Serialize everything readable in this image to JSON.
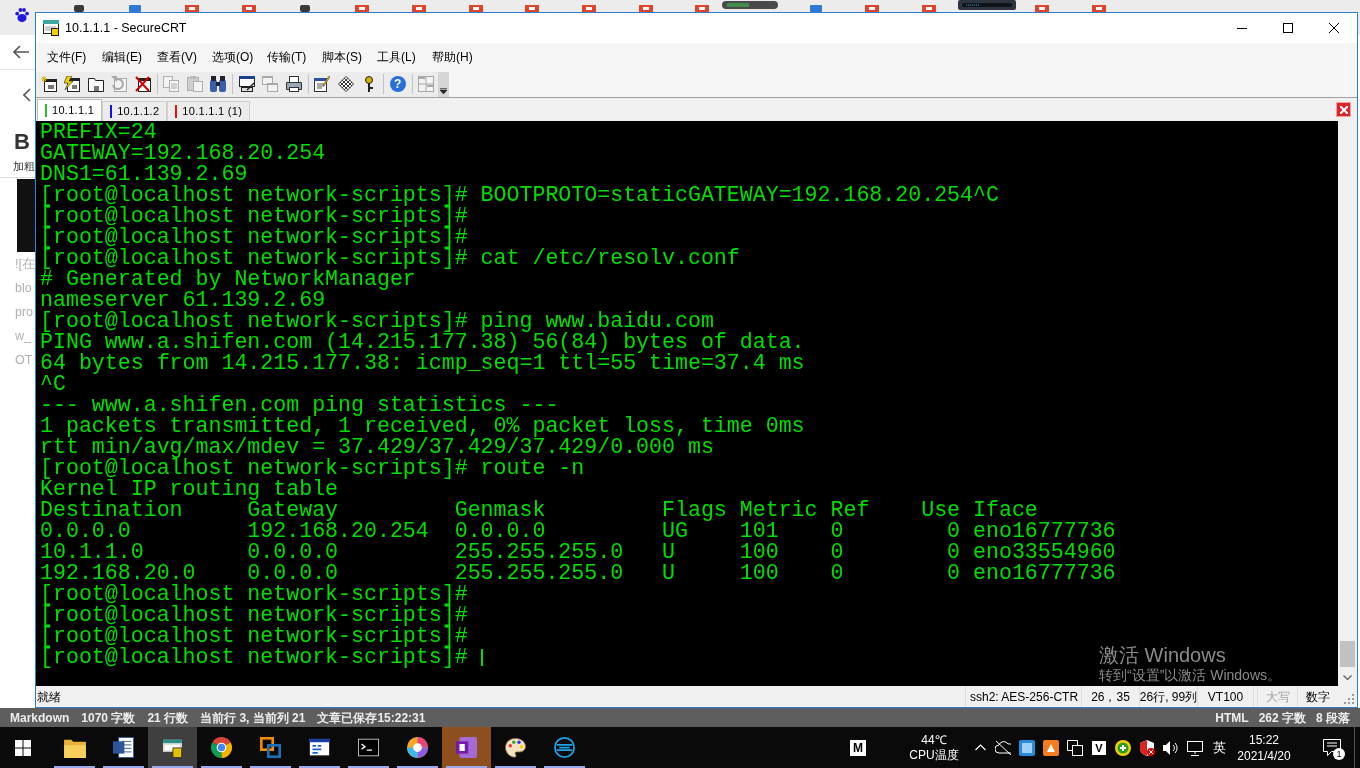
{
  "browser": {
    "editor_toolbar": {
      "bold_glyph": "B",
      "bold_label": "加粗"
    },
    "editor_lines": [
      "![在",
      "blo",
      "pro",
      "w_",
      "OT"
    ],
    "status_bar": {
      "left": [
        "Markdown",
        "1070 字数",
        "21 行数",
        "当前行 3, 当前列 21",
        "文章已保存15:22:31"
      ],
      "right": [
        "HTML",
        "262 字数",
        "8 段落"
      ]
    }
  },
  "window": {
    "title": "10.1.1.1 - SecureCRT",
    "menu": [
      "文件(F)",
      "编辑(E)",
      "查看(V)",
      "选项(O)",
      "传输(T)",
      "脚本(S)",
      "工具(L)",
      "帮助(H)"
    ],
    "toolbar": [
      [
        {
          "kind": "sparkle",
          "disabled": false
        },
        {
          "kind": "lightning",
          "disabled": false
        },
        {
          "kind": "tabfolder",
          "disabled": false
        },
        {
          "kind": "refresh",
          "disabled": true
        },
        {
          "kind": "cross",
          "disabled": false
        }
      ],
      [
        {
          "kind": "copy",
          "disabled": true
        },
        {
          "kind": "paste",
          "disabled": true
        },
        {
          "kind": "binoculars",
          "disabled": false
        }
      ],
      [
        {
          "kind": "screenpen",
          "disabled": false
        },
        {
          "kind": "screens",
          "disabled": true
        },
        {
          "kind": "printer",
          "disabled": false
        }
      ],
      [
        {
          "kind": "docpen",
          "disabled": false
        },
        {
          "kind": "checker",
          "disabled": false
        },
        {
          "kind": "key",
          "disabled": false
        }
      ],
      [
        {
          "kind": "help",
          "glyph": "?",
          "disabled": false
        }
      ],
      [
        {
          "kind": "tiles",
          "disabled": true
        }
      ]
    ],
    "tabs": [
      {
        "label": "10.1.1.1",
        "color": "#22c022",
        "selected": true
      },
      {
        "label": "10.1.1.2",
        "color": "#1010f0",
        "selected": false
      },
      {
        "label": "10.1.1.1 (1)",
        "color": "#f01010",
        "selected": false
      }
    ],
    "terminal": {
      "lines": [
        "PREFIX=24",
        "GATEWAY=192.168.20.254",
        "DNS1=61.139.2.69",
        "[root@localhost network-scripts]# BOOTPROTO=staticGATEWAY=192.168.20.254^C",
        "[root@localhost network-scripts]#",
        "[root@localhost network-scripts]#",
        "[root@localhost network-scripts]# cat /etc/resolv.conf",
        "# Generated by NetworkManager",
        "nameserver 61.139.2.69",
        "[root@localhost network-scripts]# ping www.baidu.com",
        "PING www.a.shifen.com (14.215.177.38) 56(84) bytes of data.",
        "64 bytes from 14.215.177.38: icmp_seq=1 ttl=55 time=37.4 ms",
        "^C",
        "--- www.a.shifen.com ping statistics ---",
        "1 packets transmitted, 1 received, 0% packet loss, time 0ms",
        "rtt min/avg/max/mdev = 37.429/37.429/37.429/0.000 ms",
        "[root@localhost network-scripts]# route -n",
        "Kernel IP routing table",
        "Destination     Gateway         Genmask         Flags Metric Ref    Use Iface",
        "0.0.0.0         192.168.20.254  0.0.0.0         UG    101    0        0 eno16777736",
        "10.1.1.0        0.0.0.0         255.255.255.0   U     100    0        0 eno33554960",
        "192.168.20.0    0.0.0.0         255.255.255.0   U     100    0        0 eno16777736",
        "[root@localhost network-scripts]#",
        "[root@localhost network-scripts]#",
        "[root@localhost network-scripts]#",
        "[root@localhost network-scripts]# "
      ],
      "cursor": true
    },
    "status_bar": {
      "message": "就绪",
      "cells": [
        "ssh2: AES-256-CTR",
        "26，35",
        "26行, 99列",
        "VT100"
      ],
      "indicators": [
        {
          "label": "大写",
          "on": false
        },
        {
          "label": "数字",
          "on": true
        }
      ]
    }
  },
  "activation_notice": {
    "title": "激活 Windows",
    "subtitle": "转到“设置”以激活 Windows。"
  },
  "taskbar": {
    "apps": [
      {
        "kind": "folder",
        "running": true,
        "selected": false,
        "attention": false
      },
      {
        "kind": "document",
        "running": true,
        "selected": false,
        "attention": false
      },
      {
        "kind": "securecrt",
        "running": true,
        "selected": true,
        "attention": false
      },
      {
        "kind": "browser",
        "running": true,
        "selected": false,
        "attention": false
      },
      {
        "kind": "squares",
        "running": true,
        "selected": false,
        "attention": false
      },
      {
        "kind": "window",
        "running": true,
        "selected": false,
        "attention": false
      },
      {
        "kind": "console",
        "running": true,
        "selected": false,
        "attention": false
      },
      {
        "kind": "wheel",
        "running": true,
        "selected": false,
        "attention": false
      },
      {
        "kind": "notebook",
        "running": true,
        "selected": false,
        "attention": true
      },
      {
        "kind": "palette",
        "running": true,
        "selected": false,
        "attention": false
      },
      {
        "kind": "rings",
        "running": true,
        "selected": false,
        "attention": false
      }
    ],
    "letter_tile": "M",
    "cpu": {
      "temperature": "44℃",
      "label": "CPU温度"
    },
    "tray_letter_tile": "V",
    "input_language": "英",
    "clock": {
      "time": "15:22",
      "date": "2021/4/20"
    },
    "notification_count": "1"
  }
}
